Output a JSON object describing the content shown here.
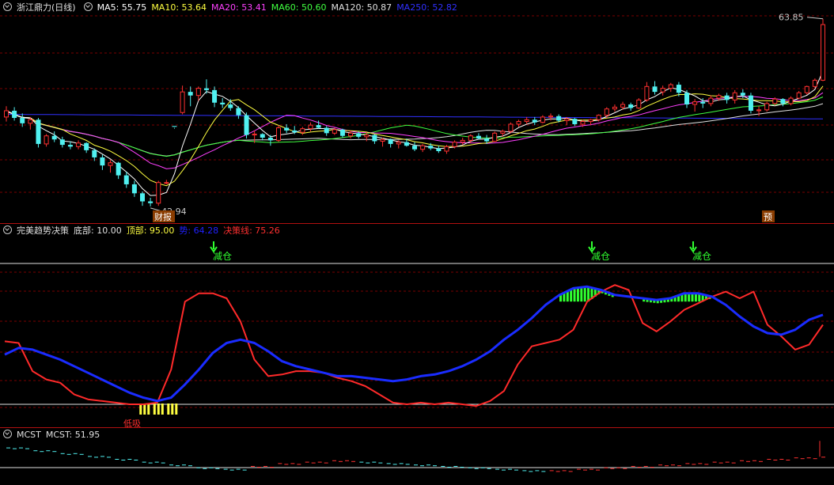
{
  "main": {
    "title": "浙江鼎力(日线)",
    "ma": [
      {
        "label": "MA5: 55.75",
        "color": "#ffffff"
      },
      {
        "label": "MA10: 53.64",
        "color": "#ffff40"
      },
      {
        "label": "MA20: 53.41",
        "color": "#ff40ff"
      },
      {
        "label": "MA60: 50.60",
        "color": "#40ff40"
      },
      {
        "label": "MA120: 50.87",
        "color": "#e0e0e0"
      },
      {
        "label": "MA250: 52.82",
        "color": "#3030ff"
      }
    ],
    "high_label": "63.85",
    "low_label": "42.94",
    "badge_left": "财报",
    "badge_right": "预",
    "colors": {
      "up": "#ff3030",
      "down": "#50f0f0",
      "grid": "#7a0000"
    }
  },
  "indicator": {
    "name": "完美趋势决策",
    "labels": [
      {
        "text": "底部: 10.00",
        "color": "#e0e0e0"
      },
      {
        "text": "顶部: 95.00",
        "color": "#ffff40"
      },
      {
        "text": "势: 64.28",
        "color": "#2020ff"
      },
      {
        "text": "决策线: 75.26",
        "color": "#ff3030"
      }
    ],
    "signal_label": "减仓",
    "bottom_label": "低吸"
  },
  "mcst": {
    "name": "MCST",
    "value_label": "MCST: 51.95"
  },
  "chart_data": [
    {
      "type": "candlestick",
      "title": "浙江鼎力(日线)",
      "candles": [
        [
          52.9,
          54.1,
          52.4,
          53.6
        ],
        [
          53.6,
          54.0,
          52.5,
          52.8
        ],
        [
          52.8,
          53.3,
          51.8,
          52.2
        ],
        [
          52.2,
          52.9,
          51.5,
          52.6
        ],
        [
          52.6,
          52.8,
          49.5,
          49.9
        ],
        [
          49.9,
          51.0,
          49.6,
          50.8
        ],
        [
          50.8,
          51.3,
          50.1,
          50.4
        ],
        [
          50.4,
          50.7,
          49.5,
          49.8
        ],
        [
          49.8,
          50.2,
          49.3,
          49.6
        ],
        [
          49.6,
          50.3,
          49.3,
          50.0
        ],
        [
          50.0,
          50.1,
          48.9,
          49.2
        ],
        [
          49.2,
          49.4,
          48.0,
          48.4
        ],
        [
          48.4,
          48.7,
          47.0,
          47.5
        ],
        [
          47.5,
          48.1,
          46.7,
          47.8
        ],
        [
          47.8,
          47.9,
          46.0,
          46.4
        ],
        [
          46.4,
          46.8,
          45.0,
          45.4
        ],
        [
          45.4,
          45.8,
          44.0,
          44.4
        ],
        [
          44.4,
          44.6,
          43.0,
          43.5
        ],
        [
          43.5,
          43.9,
          42.94,
          43.3
        ],
        [
          43.3,
          45.8,
          43.0,
          45.6
        ],
        [
          45.6,
          45.9,
          45.4,
          45.6
        ],
        [
          51.9,
          51.7,
          51.6,
          51.8
        ],
        [
          53.4,
          56.4,
          53.2,
          55.7
        ],
        [
          55.7,
          56.3,
          54.1,
          55.3
        ],
        [
          55.3,
          56.3,
          54.7,
          56.1
        ],
        [
          56.1,
          57.1,
          55.5,
          55.9
        ],
        [
          55.9,
          56.3,
          54.0,
          54.5
        ],
        [
          54.5,
          55.0,
          53.9,
          54.3
        ],
        [
          54.3,
          54.9,
          53.6,
          53.9
        ],
        [
          53.9,
          54.1,
          52.7,
          53.1
        ],
        [
          53.1,
          53.4,
          50.5,
          50.9
        ],
        [
          50.9,
          51.4,
          50.0,
          51.0
        ],
        [
          51.0,
          51.1,
          50.3,
          50.6
        ],
        [
          50.6,
          50.9,
          49.7,
          50.3
        ],
        [
          50.3,
          52.0,
          50.1,
          51.7
        ],
        [
          51.7,
          52.1,
          51.1,
          51.4
        ],
        [
          51.4,
          51.9,
          51.0,
          51.2
        ],
        [
          51.2,
          51.8,
          50.9,
          51.6
        ],
        [
          51.6,
          52.3,
          51.3,
          52.0
        ],
        [
          52.0,
          52.5,
          51.6,
          51.7
        ],
        [
          51.7,
          51.9,
          50.8,
          51.1
        ],
        [
          51.1,
          51.7,
          50.9,
          51.5
        ],
        [
          51.5,
          51.6,
          50.6,
          50.8
        ],
        [
          50.8,
          51.4,
          50.5,
          51.1
        ],
        [
          51.1,
          51.3,
          50.5,
          50.7
        ],
        [
          50.7,
          51.2,
          50.2,
          50.9
        ],
        [
          50.9,
          51.0,
          49.9,
          50.2
        ],
        [
          50.2,
          50.6,
          49.6,
          50.4
        ],
        [
          50.4,
          50.5,
          49.5,
          49.9
        ],
        [
          49.9,
          50.3,
          49.4,
          50.1
        ],
        [
          50.1,
          50.5,
          49.6,
          49.7
        ],
        [
          49.7,
          50.1,
          49.1,
          49.3
        ],
        [
          49.3,
          49.9,
          49.0,
          49.7
        ],
        [
          49.7,
          50.0,
          49.2,
          49.4
        ],
        [
          49.4,
          49.7,
          48.9,
          49.1
        ],
        [
          49.1,
          49.8,
          48.8,
          49.6
        ],
        [
          49.6,
          50.3,
          49.4,
          50.1
        ],
        [
          50.1,
          50.6,
          49.8,
          50.3
        ],
        [
          50.3,
          51.0,
          50.0,
          50.8
        ],
        [
          50.8,
          51.1,
          50.4,
          50.5
        ],
        [
          50.5,
          50.9,
          49.9,
          50.2
        ],
        [
          50.2,
          51.3,
          50.1,
          51.1
        ],
        [
          51.1,
          51.5,
          50.7,
          51.3
        ],
        [
          51.3,
          52.3,
          51.1,
          52.1
        ],
        [
          52.1,
          52.6,
          51.8,
          52.4
        ],
        [
          52.4,
          52.9,
          52.1,
          52.6
        ],
        [
          52.6,
          52.9,
          52.0,
          52.3
        ],
        [
          52.3,
          53.1,
          52.2,
          52.9
        ],
        [
          52.9,
          53.3,
          52.5,
          53.0
        ],
        [
          53.0,
          53.2,
          52.3,
          52.5
        ],
        [
          52.5,
          52.9,
          52.0,
          52.7
        ],
        [
          52.7,
          52.8,
          51.9,
          52.1
        ],
        [
          52.1,
          52.6,
          51.8,
          52.4
        ],
        [
          52.4,
          52.7,
          52.0,
          52.6
        ],
        [
          52.6,
          53.2,
          52.4,
          53.1
        ],
        [
          53.1,
          54.0,
          52.8,
          53.8
        ],
        [
          53.8,
          54.3,
          53.5,
          54.0
        ],
        [
          54.0,
          54.6,
          53.7,
          54.3
        ],
        [
          54.3,
          54.5,
          53.6,
          53.9
        ],
        [
          53.9,
          55.0,
          53.8,
          54.8
        ],
        [
          54.8,
          56.8,
          54.6,
          56.3
        ],
        [
          56.3,
          56.9,
          55.4,
          55.7
        ],
        [
          55.7,
          56.4,
          55.3,
          56.1
        ],
        [
          56.1,
          56.7,
          55.7,
          56.5
        ],
        [
          56.5,
          56.8,
          55.2,
          55.6
        ],
        [
          55.6,
          55.9,
          53.9,
          54.3
        ],
        [
          54.3,
          54.9,
          53.5,
          54.6
        ],
        [
          54.6,
          55.0,
          53.9,
          54.4
        ],
        [
          54.4,
          55.3,
          54.1,
          55.0
        ],
        [
          55.0,
          55.5,
          54.7,
          55.3
        ],
        [
          55.3,
          55.6,
          54.4,
          54.8
        ],
        [
          54.8,
          55.9,
          54.4,
          55.6
        ],
        [
          55.6,
          56.0,
          55.0,
          55.3
        ],
        [
          55.3,
          55.6,
          53.3,
          53.6
        ],
        [
          53.6,
          54.1,
          53.0,
          53.7
        ],
        [
          53.7,
          54.6,
          53.5,
          54.4
        ],
        [
          54.4,
          55.1,
          54.2,
          54.9
        ],
        [
          54.9,
          55.0,
          54.1,
          54.4
        ],
        [
          54.4,
          55.2,
          54.2,
          55.0
        ],
        [
          55.0,
          55.8,
          54.9,
          55.6
        ],
        [
          55.6,
          56.4,
          55.4,
          56.3
        ],
        [
          56.3,
          57.2,
          56.1,
          57.0
        ],
        [
          57.0,
          63.85,
          56.9,
          63.2
        ]
      ],
      "y_high": 63.85,
      "y_low": 42.94
    },
    {
      "type": "line",
      "title": "完美趋势决策",
      "series": [
        {
          "name": "势",
          "values": [
            40,
            44,
            43,
            40,
            37,
            33,
            29,
            25,
            21,
            17,
            14,
            12,
            14,
            22,
            31,
            41,
            47,
            49,
            47,
            42,
            36,
            33,
            31,
            29,
            27,
            27,
            26,
            25,
            24,
            25,
            27,
            28,
            30,
            33,
            37,
            42,
            49,
            55,
            62,
            70,
            76,
            80,
            81,
            79,
            76,
            75,
            74,
            73,
            74,
            77,
            77,
            75,
            70,
            63,
            57,
            53,
            52,
            55,
            61,
            64
          ]
        },
        {
          "name": "决策线",
          "values": [
            48,
            47,
            30,
            25,
            23,
            16,
            13,
            12,
            11,
            10,
            10,
            11,
            31,
            72,
            77,
            77,
            74,
            60,
            37,
            27,
            28,
            30,
            30,
            29,
            26,
            24,
            21,
            16,
            11,
            10,
            11,
            10,
            11,
            10,
            9,
            12,
            18,
            34,
            45,
            47,
            49,
            55,
            72,
            78,
            82,
            79,
            59,
            54,
            60,
            67,
            71,
            75,
            78,
            74,
            78,
            58,
            51,
            43,
            46,
            58
          ]
        }
      ],
      "bottom": 10.0,
      "top": 95.0,
      "ylim": [
        5,
        95
      ]
    },
    {
      "type": "line",
      "title": "MCST",
      "series": [
        {
          "name": "MCST",
          "values": [
            52.6,
            52.4,
            52.2,
            52.0,
            51.8,
            51.6,
            51.4,
            51.2,
            51.1,
            51.3,
            51.5,
            51.6,
            51.7,
            51.6,
            51.5,
            51.4,
            51.3,
            51.2,
            51.1,
            51.0,
            51.0,
            51.1,
            51.2,
            51.3,
            51.4,
            51.5,
            51.6,
            51.7,
            51.8,
            51.9,
            51.95
          ]
        }
      ]
    }
  ]
}
